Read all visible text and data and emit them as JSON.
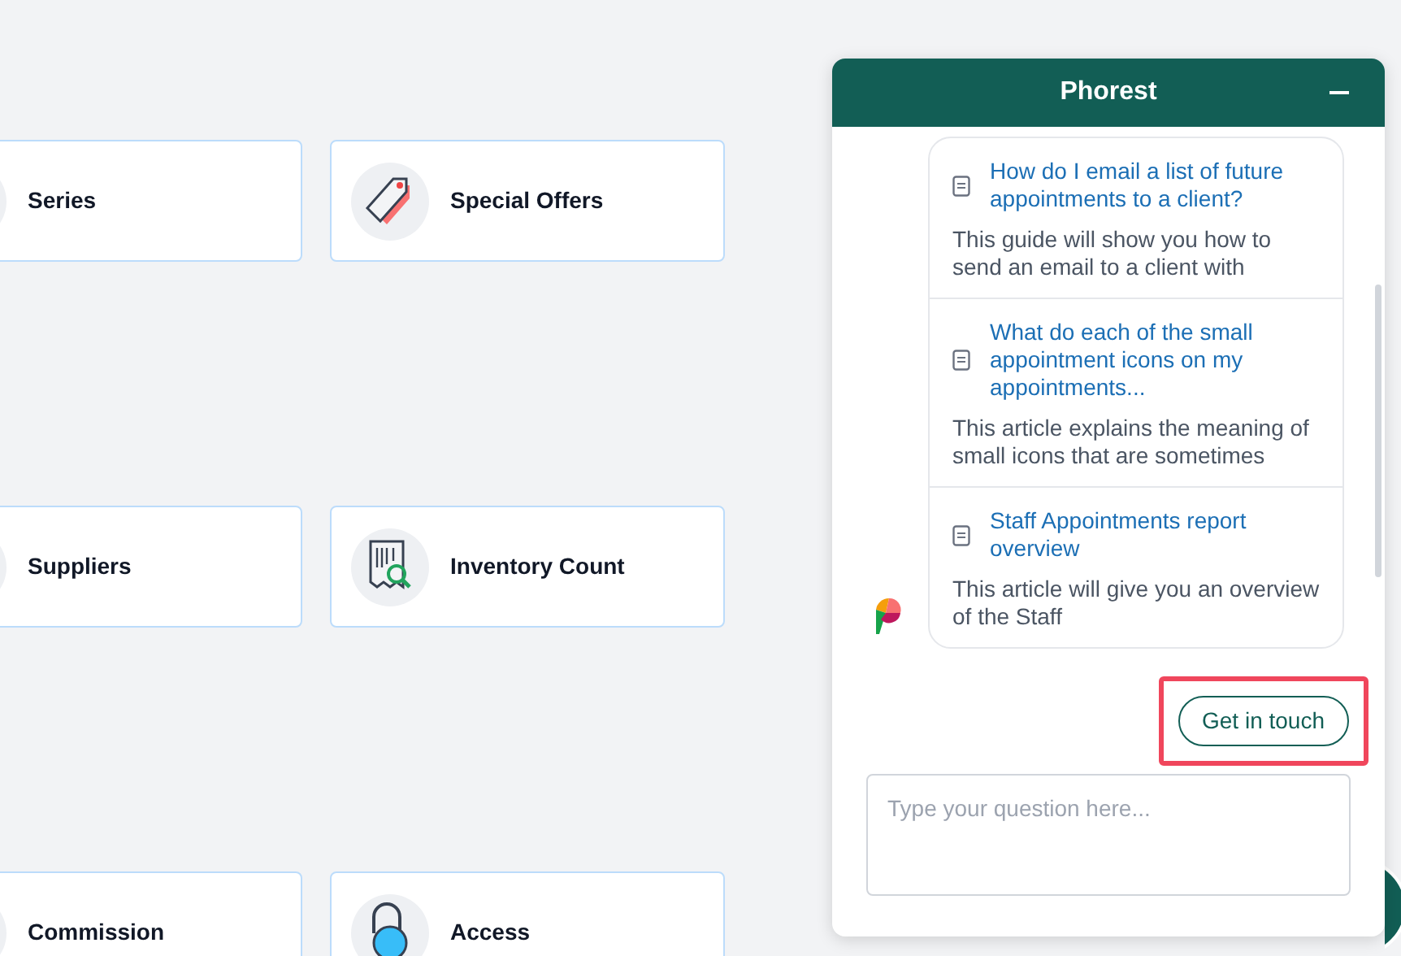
{
  "tiles": [
    {
      "label": "Series"
    },
    {
      "label": "Special Offers"
    },
    {
      "label": "Suppliers"
    },
    {
      "label": "Inventory Count"
    },
    {
      "label": "Commission"
    },
    {
      "label": "Access"
    }
  ],
  "chat": {
    "title": "Phorest",
    "articles": [
      {
        "title": "How do I email a list of future appointments to a client?",
        "summary": "This guide will show you how to send an email to a client with"
      },
      {
        "title": "What do each of the small appointment icons on my appointments...",
        "summary": "This article explains the meaning of small icons that are sometimes"
      },
      {
        "title": "Staff Appointments report overview",
        "summary": "This article will give you an overview of the Staff"
      }
    ],
    "action": {
      "label": "Get in touch",
      "highlighted": true
    },
    "input": {
      "placeholder": "Type your question here..."
    }
  }
}
